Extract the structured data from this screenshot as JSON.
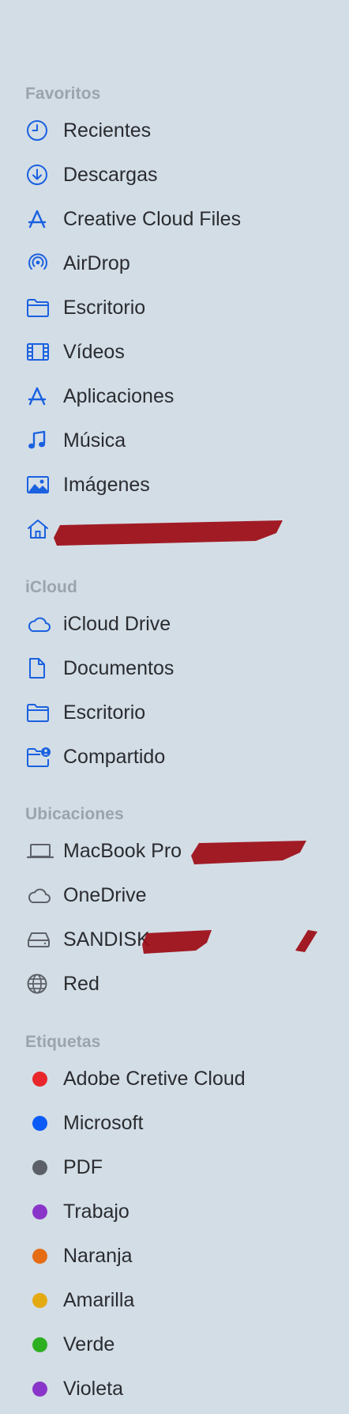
{
  "sections": {
    "favorites": {
      "title": "Favoritos",
      "items": [
        {
          "label": "Recientes",
          "icon": "clock-icon"
        },
        {
          "label": "Descargas",
          "icon": "download-icon"
        },
        {
          "label": "Creative Cloud Files",
          "icon": "creative-cloud-icon"
        },
        {
          "label": "AirDrop",
          "icon": "airdrop-icon"
        },
        {
          "label": "Escritorio",
          "icon": "folder-icon"
        },
        {
          "label": "Vídeos",
          "icon": "film-icon"
        },
        {
          "label": "Aplicaciones",
          "icon": "applications-icon"
        },
        {
          "label": "Música",
          "icon": "music-note-icon"
        },
        {
          "label": "Imágenes",
          "icon": "photo-icon"
        },
        {
          "label": "",
          "icon": "home-icon"
        }
      ]
    },
    "icloud": {
      "title": "iCloud",
      "items": [
        {
          "label": "iCloud Drive",
          "icon": "cloud-icon"
        },
        {
          "label": "Documentos",
          "icon": "document-icon"
        },
        {
          "label": "Escritorio",
          "icon": "folder-icon"
        },
        {
          "label": "Compartido",
          "icon": "shared-folder-icon"
        }
      ]
    },
    "locations": {
      "title": "Ubicaciones",
      "items": [
        {
          "label": "MacBook Pro",
          "icon": "laptop-icon"
        },
        {
          "label": "OneDrive",
          "icon": "cloud-icon"
        },
        {
          "label": "SANDISK",
          "icon": "external-drive-icon"
        },
        {
          "label": "Red",
          "icon": "globe-icon"
        }
      ]
    },
    "tags": {
      "title": "Etiquetas",
      "items": [
        {
          "label": "Adobe Cretive Cloud",
          "color": "#e8262b"
        },
        {
          "label": "Microsoft",
          "color": "#0a5bf5"
        },
        {
          "label": "PDF",
          "color": "#5b5f67"
        },
        {
          "label": "Trabajo",
          "color": "#8a35c9"
        },
        {
          "label": "Naranja",
          "color": "#e56c12"
        },
        {
          "label": "Amarilla",
          "color": "#e4aa12"
        },
        {
          "label": "Verde",
          "color": "#2db020"
        },
        {
          "label": "Violeta",
          "color": "#8a35c9"
        }
      ]
    }
  },
  "colors": {
    "accent": "#1a61e0",
    "gray_icon": "#5e6268",
    "background": "#d3dde6",
    "redaction": "#9c0a14"
  }
}
